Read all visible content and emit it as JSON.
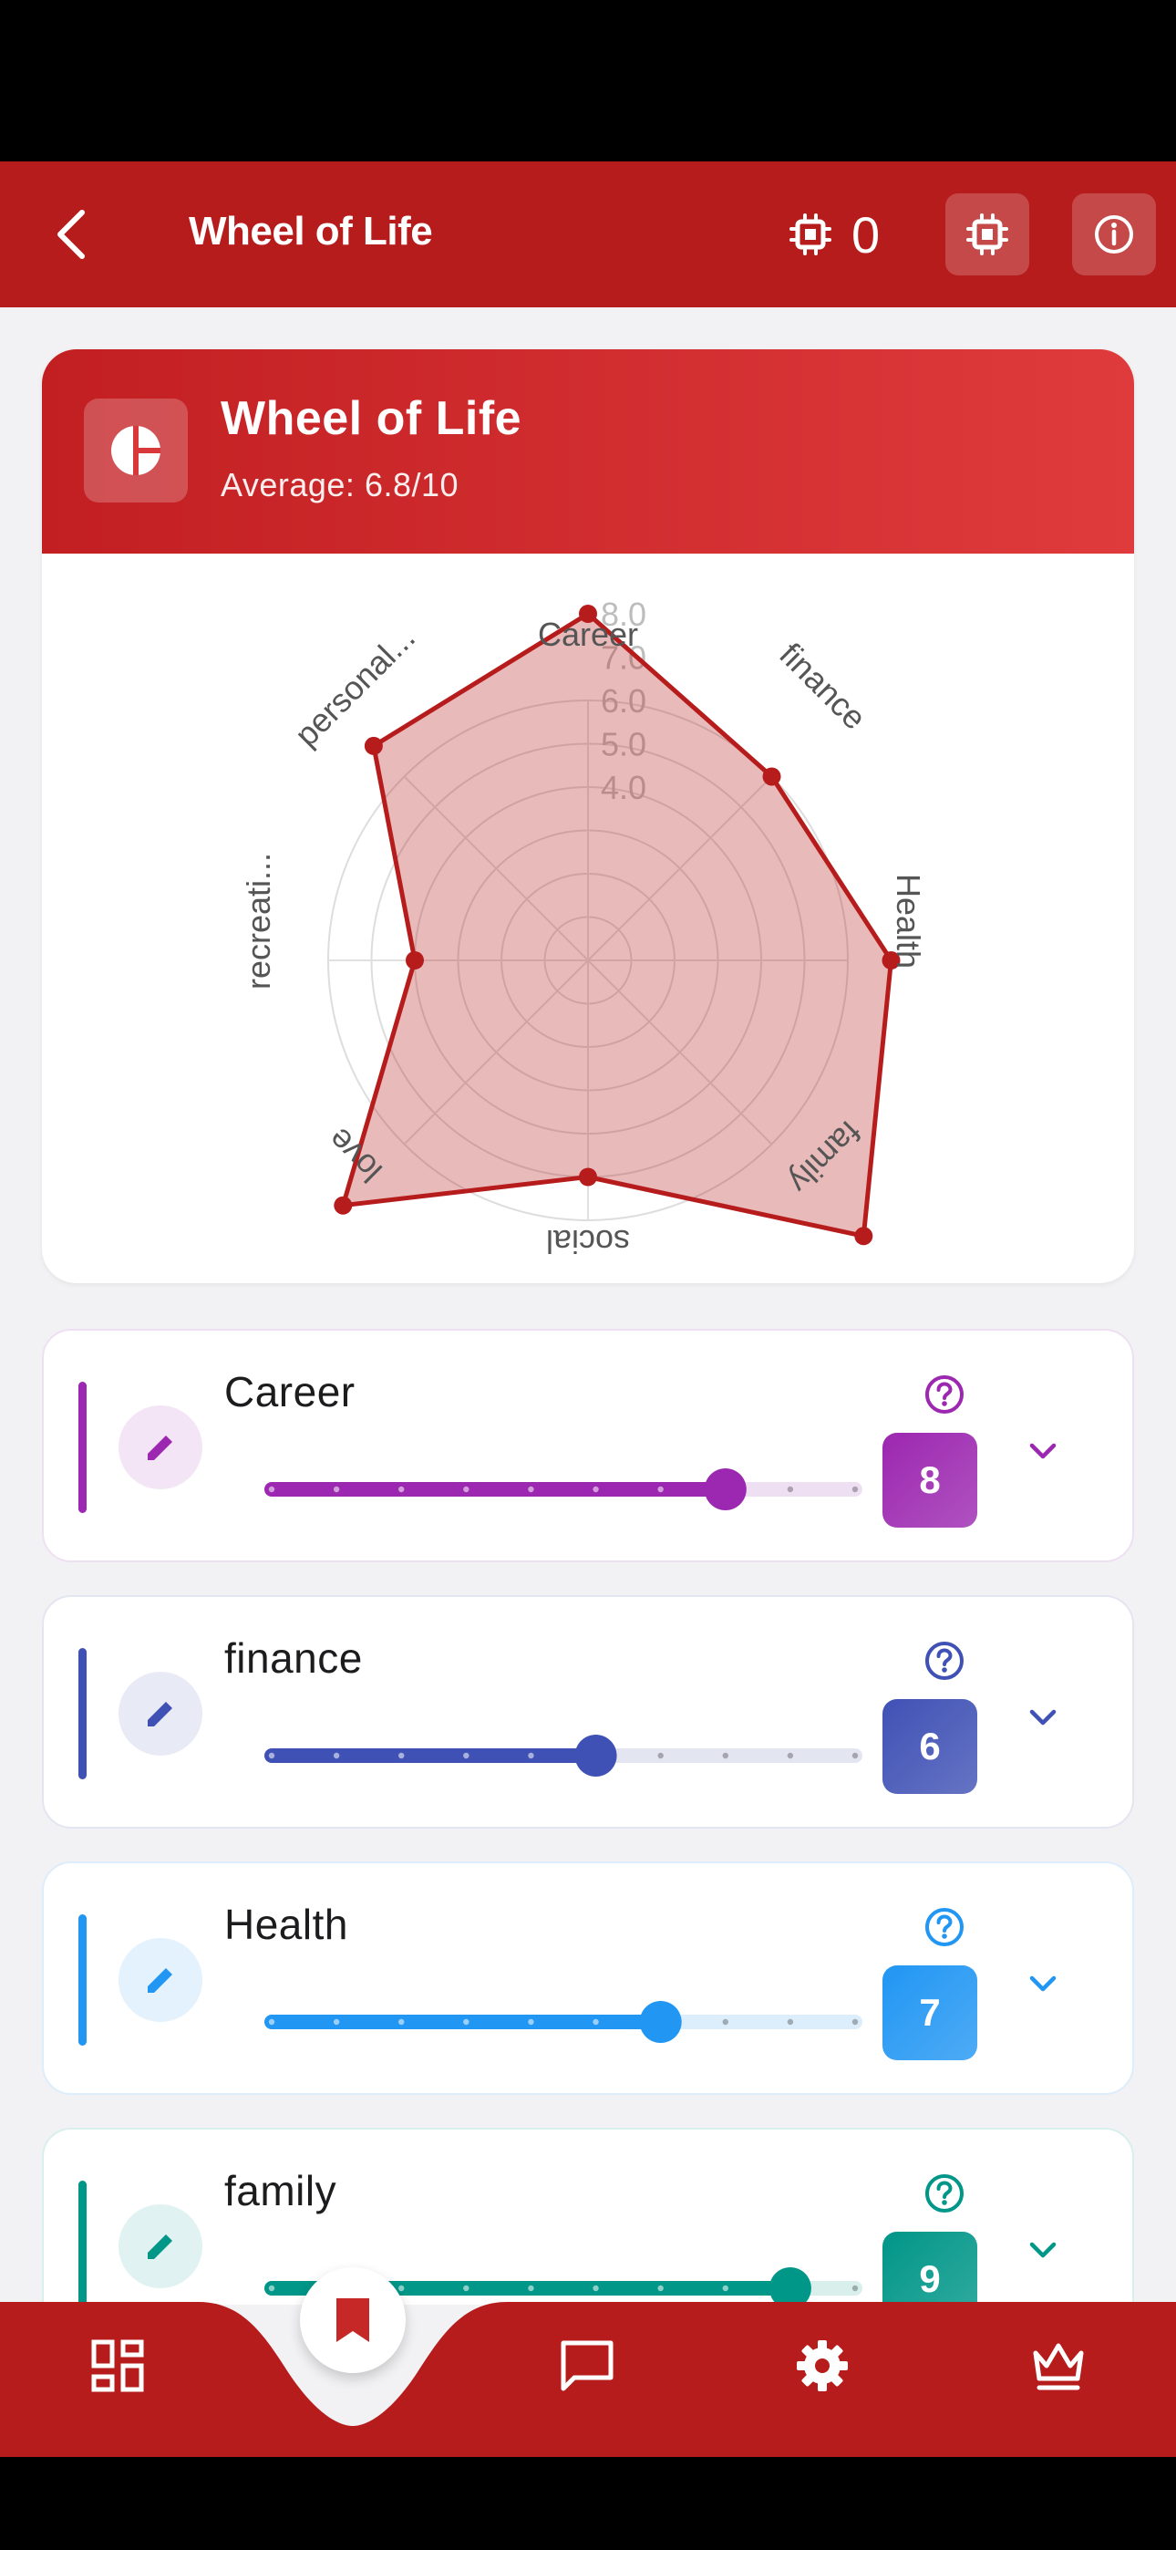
{
  "app_bar": {
    "title": "Wheel of Life",
    "credits": "0"
  },
  "wheel": {
    "title": "Wheel of Life",
    "average": "Average: 6.8/10",
    "axes": [
      "Career",
      "finance",
      "Health",
      "family",
      "social",
      "love",
      "recreati...",
      "personal..."
    ],
    "ring_labels": [
      "8.0",
      "7.0",
      "6.0",
      "5.0",
      "4.0"
    ]
  },
  "chart_data": {
    "type": "radar",
    "categories": [
      "Career",
      "finance",
      "Health",
      "family",
      "social",
      "love",
      "recreation",
      "personal"
    ],
    "values": [
      8,
      6,
      7,
      9,
      5,
      8,
      4,
      7
    ],
    "rings": [
      4.0,
      5.0,
      6.0,
      7.0,
      8.0
    ],
    "color": "#b71c1c"
  },
  "categories": [
    {
      "name": "Career",
      "value": "8",
      "level": 8,
      "color": "#9c27b0",
      "light": "#f3e5f5",
      "track": "#efdff2"
    },
    {
      "name": "finance",
      "value": "6",
      "level": 6,
      "color": "#3f51b5",
      "light": "#e8eaf6",
      "track": "#e3e5f1"
    },
    {
      "name": "Health",
      "value": "7",
      "level": 7,
      "color": "#2196f3",
      "light": "#e3f2fd",
      "track": "#dcedfb"
    },
    {
      "name": "family",
      "value": "9",
      "level": 9,
      "color": "#009688",
      "light": "#e0f2f1",
      "track": "#d8efec"
    }
  ],
  "colors": {
    "primary": "#b71c1c",
    "nav_icon": "#ffffff",
    "fab_icon": "#c62828"
  },
  "nav": {
    "items": [
      "dashboard-icon",
      "chat-icon",
      "settings-icon",
      "crown-icon"
    ],
    "active": "bookmark-icon"
  }
}
